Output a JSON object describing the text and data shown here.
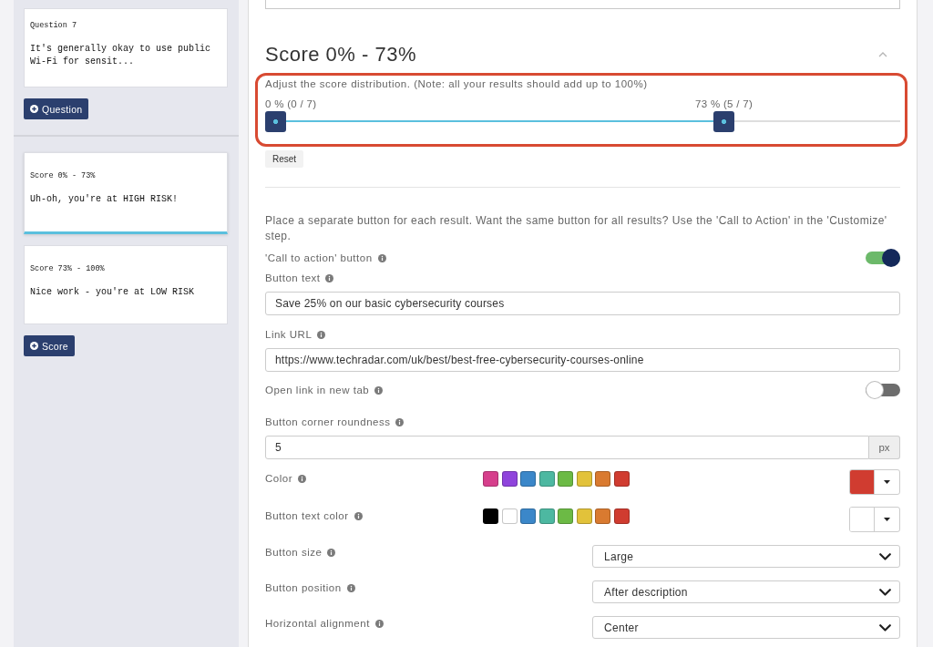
{
  "sidebar": {
    "question_cards": [
      {
        "label": "Question 7",
        "text": "It's generally okay to use public Wi-Fi for sensit...",
        "selected": false
      }
    ],
    "add_question_button": "Question",
    "score_cards": [
      {
        "label": "Score 0% - 73%",
        "text": "Uh-oh, you're at HIGH RISK!",
        "selected": true
      },
      {
        "label": "Score 73% - 100%",
        "text": "Nice work - you're at LOW RISK",
        "selected": false
      }
    ],
    "add_score_button": "Score"
  },
  "editor": {
    "title": "Score 0% - 73%",
    "expanded": true,
    "score_range": {
      "highlighted": true,
      "hint": "Adjust the score distribution. (Note: all your results should add up to 100%)",
      "handles": [
        {
          "label": "0 % (0 / 7)",
          "level": 0
        },
        {
          "label": "73 % (5 / 7)",
          "level": 0.73
        }
      ],
      "reset_button": "Reset"
    },
    "intro": "Place a separate button for each result. Want the same button for all results? Use the 'Call to Action' in the 'Customize' step.",
    "settings": [
      {
        "kind": "toggle",
        "label": "'Call to action' button",
        "on": true
      },
      {
        "kind": "text",
        "label": "Button text",
        "value": "Save 25% on our basic cybersecurity courses"
      },
      {
        "kind": "text",
        "label": "Link URL",
        "value": "https://www.techradar.com/uk/best/best-free-cybersecurity-courses-online"
      },
      {
        "kind": "toggle",
        "label": "Open link in new tab",
        "on": false
      },
      {
        "kind": "number",
        "label": "Button corner roundness",
        "value": "5",
        "unit": "px"
      },
      {
        "kind": "color",
        "label": "Color",
        "swatches": [
          {
            "color": "#d63f8c"
          },
          {
            "color": "#8f44dc"
          },
          {
            "color": "#3b87c9"
          },
          {
            "color": "#4db8a1"
          },
          {
            "color": "#6cba45"
          },
          {
            "color": "#e2c23a"
          },
          {
            "color": "#d97a30"
          },
          {
            "color": "#d03c30"
          }
        ],
        "color": "#d03c30"
      },
      {
        "kind": "color",
        "label": "Button text color",
        "swatches": [
          {
            "color": "#000000"
          },
          {
            "color": "#ffffff"
          },
          {
            "color": "#3b87c9"
          },
          {
            "color": "#4db8a1"
          },
          {
            "color": "#6cba45"
          },
          {
            "color": "#e2c23a"
          },
          {
            "color": "#d97a30"
          },
          {
            "color": "#d03c30"
          }
        ],
        "color": "#ffffff"
      },
      {
        "kind": "select",
        "label": "Button size",
        "value": "Large"
      },
      {
        "kind": "select",
        "label": "Button position",
        "value": "After description"
      },
      {
        "kind": "select",
        "label": "Horizontal alignment",
        "value": "Center"
      }
    ]
  }
}
